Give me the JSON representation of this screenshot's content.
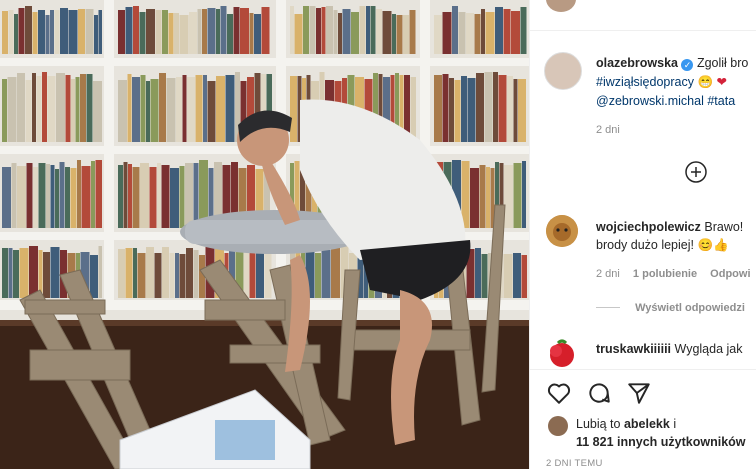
{
  "post": {
    "author": "olazebrowska",
    "caption_line1": "Zgolił bro",
    "hashtags_line2": "#iwziąłsiędopracy",
    "emoji_line2": "😁 ❤",
    "line3_mention": "@zebrowski.michal",
    "line3_tag": "#tata",
    "time": "2 dni"
  },
  "comments": [
    {
      "user": "wojciechpolewicz",
      "text1": "Brawo!",
      "text2": "brody dużo lepiej! 😊👍",
      "time": "2 dni",
      "likes": "1 polubienie",
      "reply": "Odpowi",
      "view_replies": "Wyświetl odpowiedzi"
    },
    {
      "user": "truskawkiiiiii",
      "text1": "Wygląda jak"
    }
  ],
  "likes": {
    "line1_prefix": "Lubią to",
    "line1_user": "abelekk",
    "line1_suffix": "i",
    "line2": "11 821 innych użytkowników"
  },
  "date_footer": "2 DNI TEMU",
  "icons": [
    "verified-badge-icon",
    "add-comment-icon",
    "heart-icon",
    "comment-icon",
    "share-icon"
  ],
  "colors": {
    "verified": "#3897f0",
    "link": "#00376b",
    "muted": "#8e8e8e",
    "text": "#262626"
  }
}
